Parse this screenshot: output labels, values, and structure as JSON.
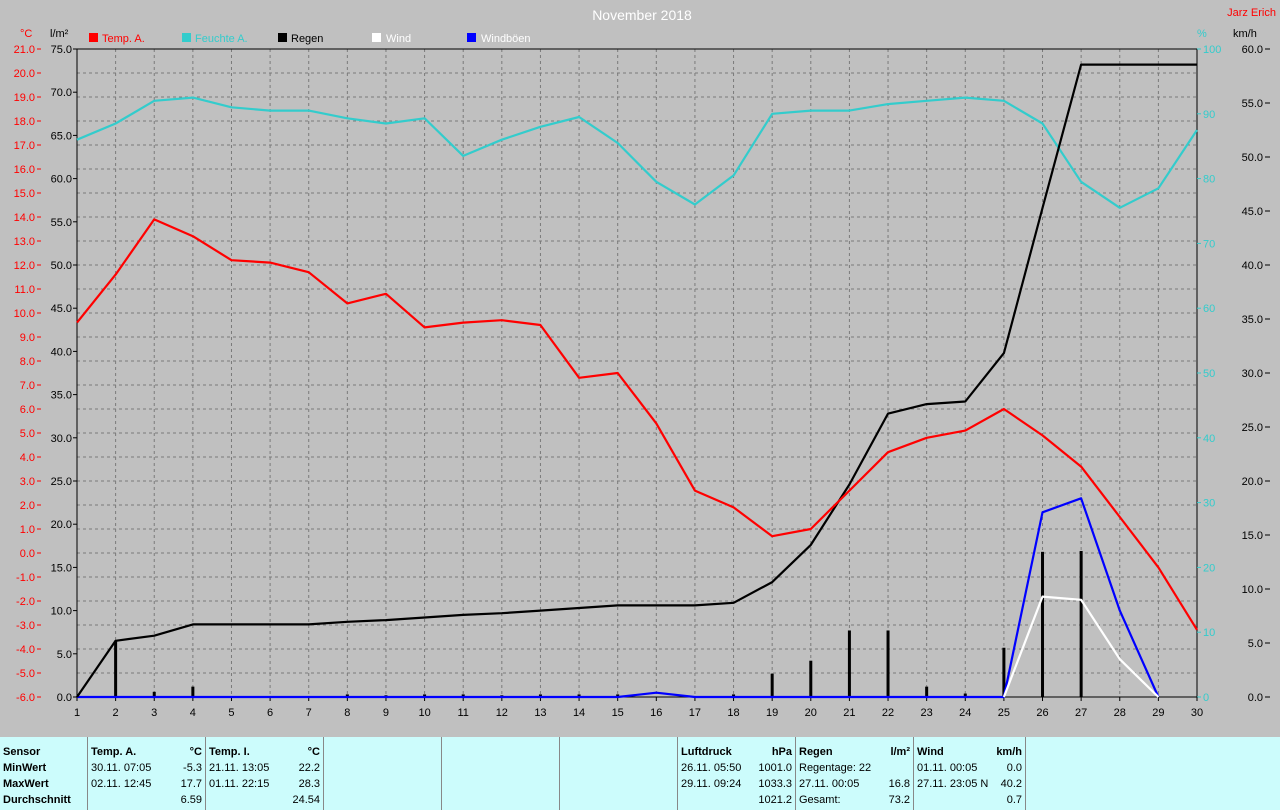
{
  "chart_data": {
    "type": "line",
    "title": "November 2018",
    "author": "Jarz Erich",
    "axis_labels": {
      "temp": "°C",
      "rain": "l/m²",
      "humidity": "%",
      "wind": "km/h"
    },
    "x": {
      "min": 1,
      "max": 30,
      "ticks": [
        "1",
        "2",
        "3",
        "4",
        "5",
        "6",
        "7",
        "8",
        "9",
        "10",
        "11",
        "12",
        "13",
        "14",
        "15",
        "16",
        "17",
        "18",
        "19",
        "20",
        "21",
        "22",
        "23",
        "24",
        "25",
        "26",
        "27",
        "28",
        "29",
        "30"
      ]
    },
    "axes": {
      "temp": {
        "min": -6,
        "max": 21,
        "step": 1,
        "color": "#ff0000",
        "side": "left-outer"
      },
      "rain": {
        "min": 0,
        "max": 75,
        "step": 5,
        "color": "#000000",
        "side": "left-inner"
      },
      "humidity": {
        "min": 0,
        "max": 100,
        "step": 10,
        "color": "#33cccc",
        "side": "right-inner"
      },
      "wind": {
        "min": 0,
        "max": 60,
        "step": 5,
        "color": "#000000",
        "side": "right-outer"
      }
    },
    "grid": true,
    "legend_position": "top-left",
    "series": [
      {
        "name": "Temp. A.",
        "axis": "temp",
        "color": "#ff0000",
        "x": [
          1,
          2,
          3,
          4,
          5,
          6,
          7,
          8,
          9,
          10,
          11,
          12,
          13,
          14,
          15,
          16,
          17,
          18,
          19,
          20,
          21,
          22,
          23,
          24,
          25,
          26,
          27,
          28,
          29,
          30
        ],
        "values": [
          9.6,
          11.6,
          13.9,
          13.2,
          12.2,
          12.1,
          11.7,
          10.4,
          10.8,
          9.4,
          9.6,
          9.7,
          9.5,
          7.3,
          7.5,
          5.4,
          2.6,
          1.9,
          0.7,
          1.0,
          2.6,
          4.2,
          4.8,
          5.1,
          6.0,
          4.9,
          3.6,
          1.5,
          -0.6,
          -3.2
        ]
      },
      {
        "name": "Feuchte A.",
        "axis": "humidity",
        "color": "#33cccc",
        "x": [
          1,
          2,
          3,
          4,
          5,
          6,
          7,
          8,
          9,
          10,
          11,
          12,
          13,
          14,
          15,
          16,
          17,
          18,
          19,
          20,
          21,
          22,
          23,
          24,
          25,
          26,
          27,
          28,
          29,
          30
        ],
        "values": [
          86,
          88.5,
          92,
          92.5,
          91,
          90.5,
          90.5,
          89.3,
          88.5,
          89.3,
          83.5,
          86,
          88,
          89.5,
          85.5,
          79.5,
          76,
          80.5,
          90,
          90.5,
          90.5,
          91.5,
          92,
          92.5,
          92,
          88.5,
          79.5,
          75.5,
          78.5,
          87.5
        ]
      },
      {
        "name": "Regen",
        "axis": "rain",
        "type": "line",
        "color": "#000000",
        "x": [
          1,
          2,
          3,
          4,
          5,
          6,
          7,
          8,
          9,
          10,
          11,
          12,
          13,
          14,
          15,
          16,
          17,
          18,
          19,
          20,
          21,
          22,
          23,
          24,
          25,
          26,
          27,
          28,
          29,
          30
        ],
        "values": [
          0,
          6.5,
          7.1,
          8.4,
          8.4,
          8.4,
          8.4,
          8.7,
          8.9,
          9.2,
          9.5,
          9.7,
          10,
          10.3,
          10.6,
          10.6,
          10.6,
          10.9,
          13.3,
          17.6,
          24.6,
          32.8,
          33.9,
          34.2,
          39.8,
          56.6,
          73.2,
          73.2,
          73.2,
          73.2
        ]
      },
      {
        "name": "Regen",
        "axis": "rain",
        "type": "bar",
        "color": "#000000",
        "x": [
          2,
          3,
          4,
          8,
          9,
          10,
          11,
          12,
          13,
          14,
          15,
          18,
          19,
          20,
          21,
          22,
          23,
          24,
          25,
          26,
          27
        ],
        "values": [
          6.5,
          0.6,
          1.2,
          0.3,
          0.2,
          0.3,
          0.3,
          0.2,
          0.3,
          0.3,
          0.3,
          0.3,
          2.7,
          4.2,
          7.7,
          7.7,
          1.2,
          0.4,
          5.7,
          16.8,
          16.9
        ]
      },
      {
        "name": "Wind",
        "axis": "wind",
        "color": "#ffffff",
        "x": [
          25,
          26,
          27,
          28,
          29
        ],
        "values": [
          0,
          9.3,
          9.0,
          3.5,
          0
        ]
      },
      {
        "name": "Windböen",
        "axis": "wind",
        "color": "#0000ff",
        "x": [
          1,
          2,
          15,
          16,
          17,
          25,
          26,
          27,
          28,
          29
        ],
        "values": [
          0,
          0,
          0,
          0.4,
          0,
          0,
          17.1,
          18.4,
          8.0,
          0
        ]
      }
    ]
  },
  "footer": {
    "sensor": {
      "header": "Sensor",
      "rows": [
        "MinWert",
        "MaxWert",
        "Durchschnitt"
      ]
    },
    "temp_a": {
      "header": "Temp. A.",
      "unit": "°C",
      "rows": [
        [
          "30.11.  07:05",
          "-5.3"
        ],
        [
          "02.11.  12:45",
          "17.7"
        ],
        [
          "",
          "6.59"
        ]
      ]
    },
    "temp_i": {
      "header": "Temp. I.",
      "unit": "°C",
      "rows": [
        [
          "21.11.  13:05",
          "22.2"
        ],
        [
          "01.11.  22:15",
          "28.3"
        ],
        [
          "",
          "24.54"
        ]
      ]
    },
    "luftdruck": {
      "header": "Luftdruck",
      "unit": "hPa",
      "rows": [
        [
          "26.11.  05:50",
          "1001.0"
        ],
        [
          "29.11.  09:24",
          "1033.3"
        ],
        [
          "",
          "1021.2"
        ]
      ]
    },
    "regen": {
      "header": "Regen",
      "unit": "l/m²",
      "rows": [
        [
          "Regentage: 22",
          ""
        ],
        [
          "27.11.  00:05",
          "16.8"
        ],
        [
          "Gesamt:",
          "73.2"
        ]
      ]
    },
    "wind": {
      "header": "Wind",
      "unit": "km/h",
      "rows": [
        [
          "01.11.  00:05",
          "0.0"
        ],
        [
          "27.11.  23:05  N",
          "40.2"
        ],
        [
          "",
          "0.7"
        ]
      ]
    }
  }
}
